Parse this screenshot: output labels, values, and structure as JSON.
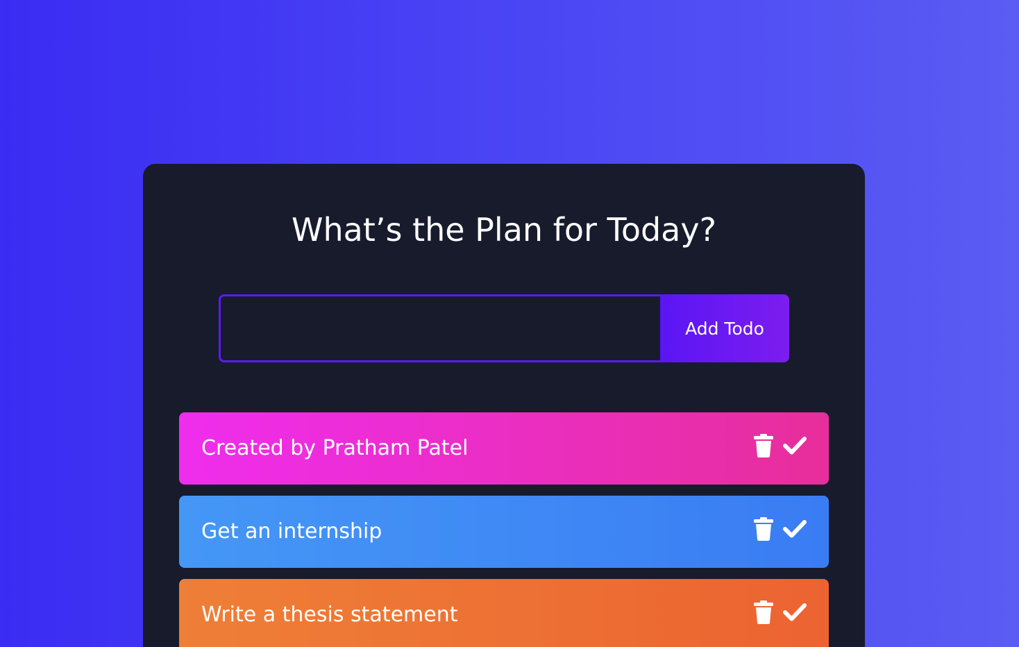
{
  "header": {
    "title": "What’s the Plan for Today?"
  },
  "form": {
    "input_value": "",
    "input_placeholder": "",
    "add_label": "Add Todo"
  },
  "todos": [
    {
      "text": "Created by Pratham Patel",
      "color_start": "#ef2dee",
      "color_end": "#e72e9a",
      "delete_icon": "trash-icon",
      "complete_icon": "check-icon"
    },
    {
      "text": "Get an internship",
      "color_start": "#4597f6",
      "color_end": "#3a7cf4",
      "delete_icon": "trash-icon",
      "complete_icon": "check-icon"
    },
    {
      "text": "Write a thesis statement",
      "color_start": "#ee7f37",
      "color_end": "#ec6331",
      "delete_icon": "trash-icon",
      "complete_icon": "check-icon"
    }
  ],
  "colors": {
    "background_start": "#3b2cf3",
    "background_end": "#5a5cf3",
    "panel": "#171b2c",
    "accent": "#5b1bf2"
  }
}
